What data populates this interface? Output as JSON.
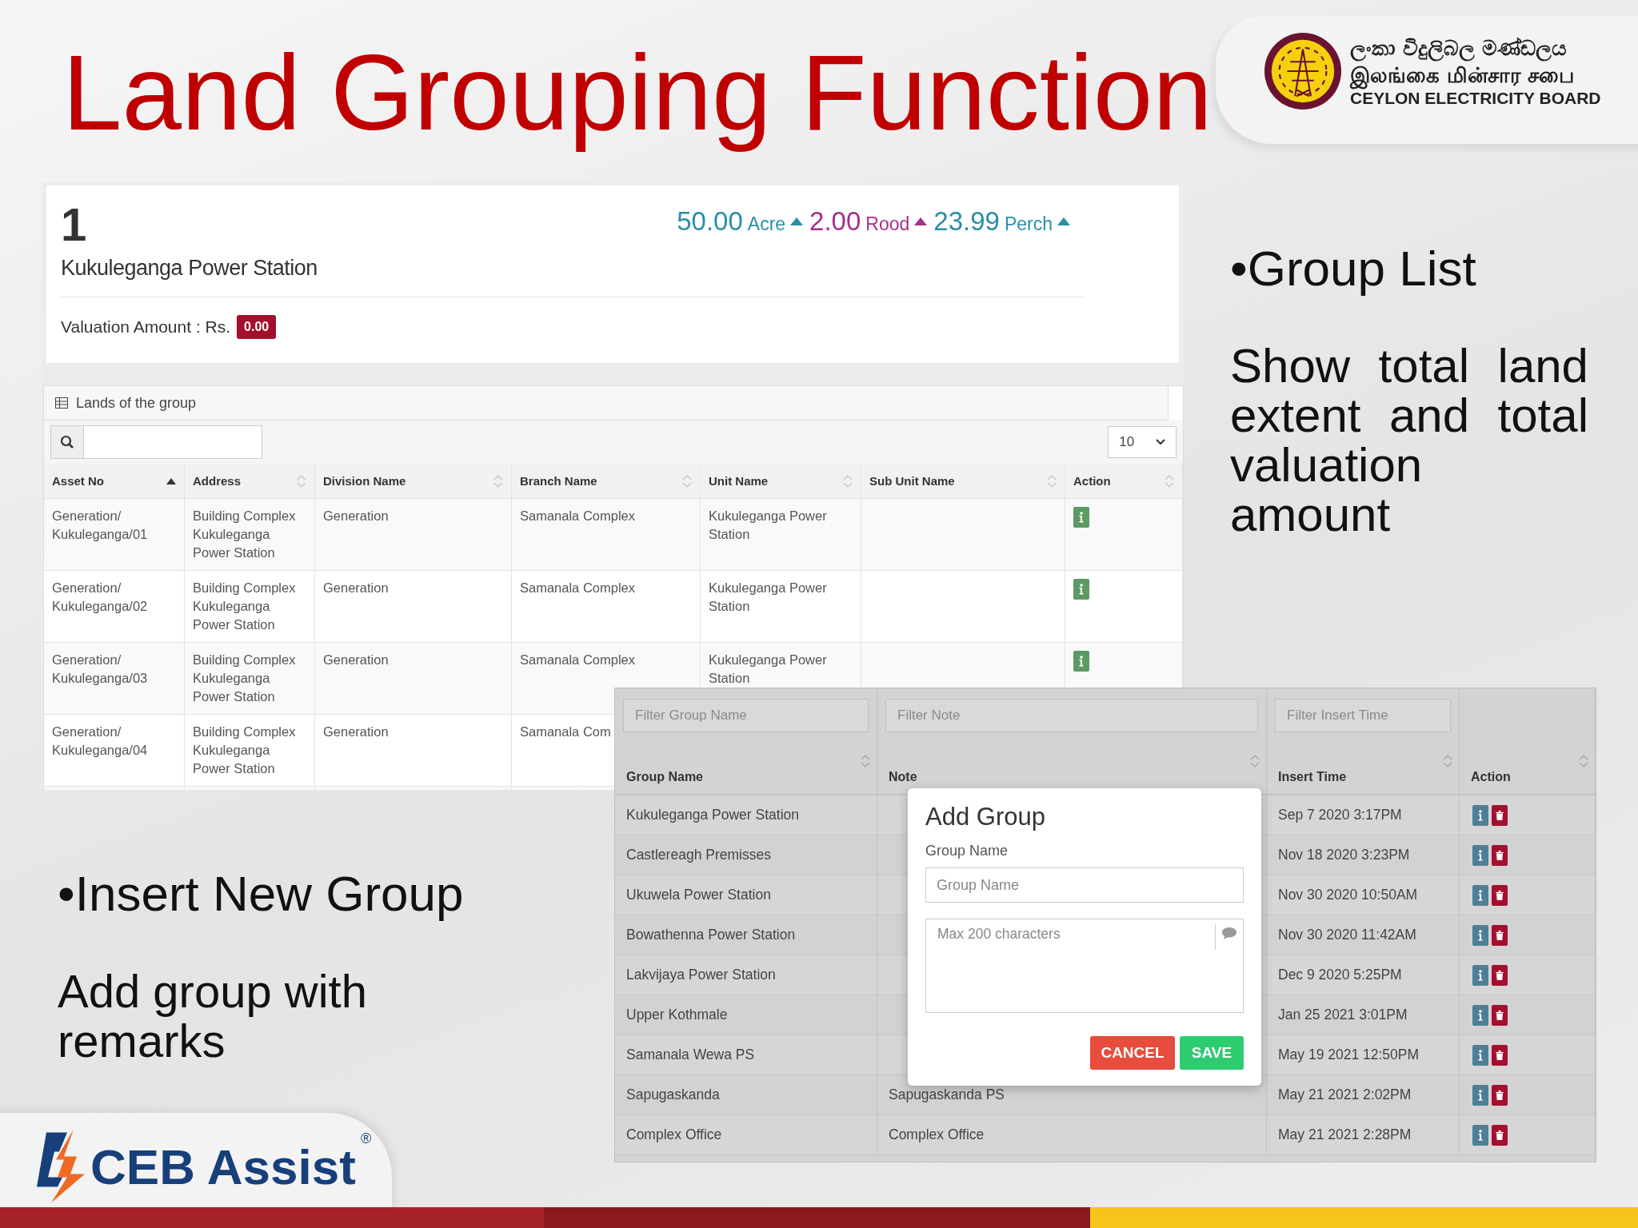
{
  "slide": {
    "title": "Land Grouping Function"
  },
  "org_logo": {
    "lines": [
      "ලංකා විදුලිබල මණ්ඩලය",
      "இலங்கை மின்சார சபை",
      "CEYLON ELECTRICITY BOARD"
    ]
  },
  "group_card": {
    "number": "1",
    "name": "Kukuleganga Power Station",
    "extents": [
      {
        "value": "50.00",
        "unit": "Acre",
        "color": "#2b8ea6"
      },
      {
        "value": "2.00",
        "unit": "Rood",
        "color": "#a52f8a"
      },
      {
        "value": "23.99",
        "unit": "Perch",
        "color": "#2b8ea6"
      }
    ],
    "valuation_label": "Valuation Amount : Rs.",
    "valuation_badge": "0.00"
  },
  "lands_table": {
    "title": "Lands of the group",
    "page_size": "10",
    "columns": [
      {
        "label": "Asset No",
        "sorted_ascending": true
      },
      {
        "label": "Address",
        "sorted_ascending": false
      },
      {
        "label": "Division Name",
        "sorted_ascending": false
      },
      {
        "label": "Branch Name",
        "sorted_ascending": false
      },
      {
        "label": "Unit Name",
        "sorted_ascending": false
      },
      {
        "label": "Sub Unit Name",
        "sorted_ascending": false
      },
      {
        "label": "Action",
        "sorted_ascending": false
      }
    ],
    "rows": [
      {
        "cells": [
          "Generation/ Kukuleganga/01",
          "Building Complex Kukuleganga Power Station",
          "Generation",
          "Samanala Complex",
          "Kukuleganga Power Station"
        ],
        "info": true
      },
      {
        "cells": [
          "Generation/ Kukuleganga/02",
          "Building Complex Kukuleganga Power Station",
          "Generation",
          "Samanala Complex",
          "Kukuleganga Power Station"
        ],
        "info": true
      },
      {
        "cells": [
          "Generation/ Kukuleganga/03",
          "Building Complex Kukuleganga Power Station",
          "Generation",
          "Samanala Complex",
          "Kukuleganga Power Station"
        ],
        "info": true
      },
      {
        "cells": [
          "Generation/ Kukuleganga/04",
          "Building Complex Kukuleganga Power Station",
          "Generation",
          "Samanala Com"
        ]
      }
    ]
  },
  "group_list": {
    "heading": "•Group List",
    "body": "Show total land extent and total valuation amount"
  },
  "groups_table": {
    "filters": [
      "Filter Group Name",
      "Filter Note",
      "Filter Insert Time"
    ],
    "columns": [
      {
        "label": "Group Name"
      },
      {
        "label": "Note"
      },
      {
        "label": "Insert Time"
      },
      {
        "label": "Action"
      }
    ],
    "rows": [
      {
        "group_name": "Kukuleganga Power Station",
        "insert_time": "Sep 7 2020 3:17PM"
      },
      {
        "group_name": "Castlereagh Premisses",
        "insert_time": "Nov 18 2020 3:23PM"
      },
      {
        "group_name": "Ukuwela Power Station",
        "insert_time": "Nov 30 2020 10:50AM"
      },
      {
        "group_name": "Bowathenna Power Station",
        "insert_time": "Nov 30 2020 11:42AM"
      },
      {
        "group_name": "Lakvijaya Power Station",
        "insert_time": "Dec 9 2020 5:25PM"
      },
      {
        "group_name": "Upper Kothmale",
        "insert_time": "Jan 25 2021 3:01PM"
      },
      {
        "group_name": "Samanala Wewa PS",
        "insert_time": "May 19 2021 12:50PM"
      },
      {
        "group_name": "Sapugaskanda",
        "note": "Sapugaskanda PS",
        "insert_time": "May 21 2021 2:02PM"
      },
      {
        "group_name": "Complex Office",
        "note": "Complex Office",
        "insert_time": "May 21 2021 2:28PM"
      }
    ]
  },
  "modal": {
    "title": "Add Group",
    "field_label": "Group Name",
    "name_placeholder": "Group Name",
    "note_placeholder": "Max 200 characters",
    "buttons": [
      {
        "label": "CANCEL",
        "kind": "cancel"
      },
      {
        "label": "SAVE",
        "kind": "save"
      }
    ]
  },
  "insert_group": {
    "heading": "•Insert New Group",
    "body": "Add group with remarks"
  },
  "brand": {
    "name": "CEB Assist",
    "mark": "®"
  }
}
